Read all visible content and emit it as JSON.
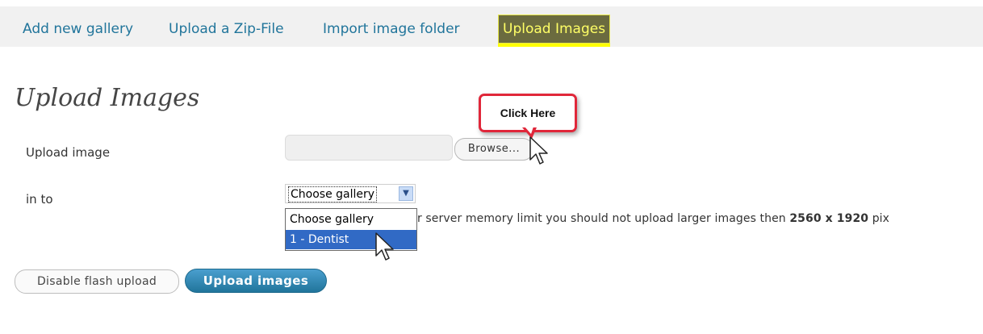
{
  "tabs": [
    {
      "label": "Add new gallery"
    },
    {
      "label": "Upload a Zip-File"
    },
    {
      "label": "Import image folder"
    },
    {
      "label": "Upload Images"
    }
  ],
  "page_title": "Upload Images",
  "form": {
    "upload_label": "Upload image",
    "browse_label": "Browse...",
    "into_label": "in to",
    "gallery_selected": "Choose gallery",
    "gallery_options": [
      "Choose gallery",
      "1 - Dentist"
    ],
    "note_prefix": "u",
    "note_text": "r server memory limit you should not upload larger images then ",
    "note_size": "2560 x 1920",
    "note_suffix": " pix"
  },
  "callout": {
    "text": "Click Here",
    "color": "#e0273a"
  },
  "buttons": {
    "disable_flash": "Disable flash upload",
    "upload": "Upload images"
  },
  "colors": {
    "link": "#21759b",
    "active_tab_bg": "#6b6b3f",
    "active_tab_text": "#ffff66",
    "primary_button": "#21759b",
    "selected_option": "#316ac5"
  }
}
